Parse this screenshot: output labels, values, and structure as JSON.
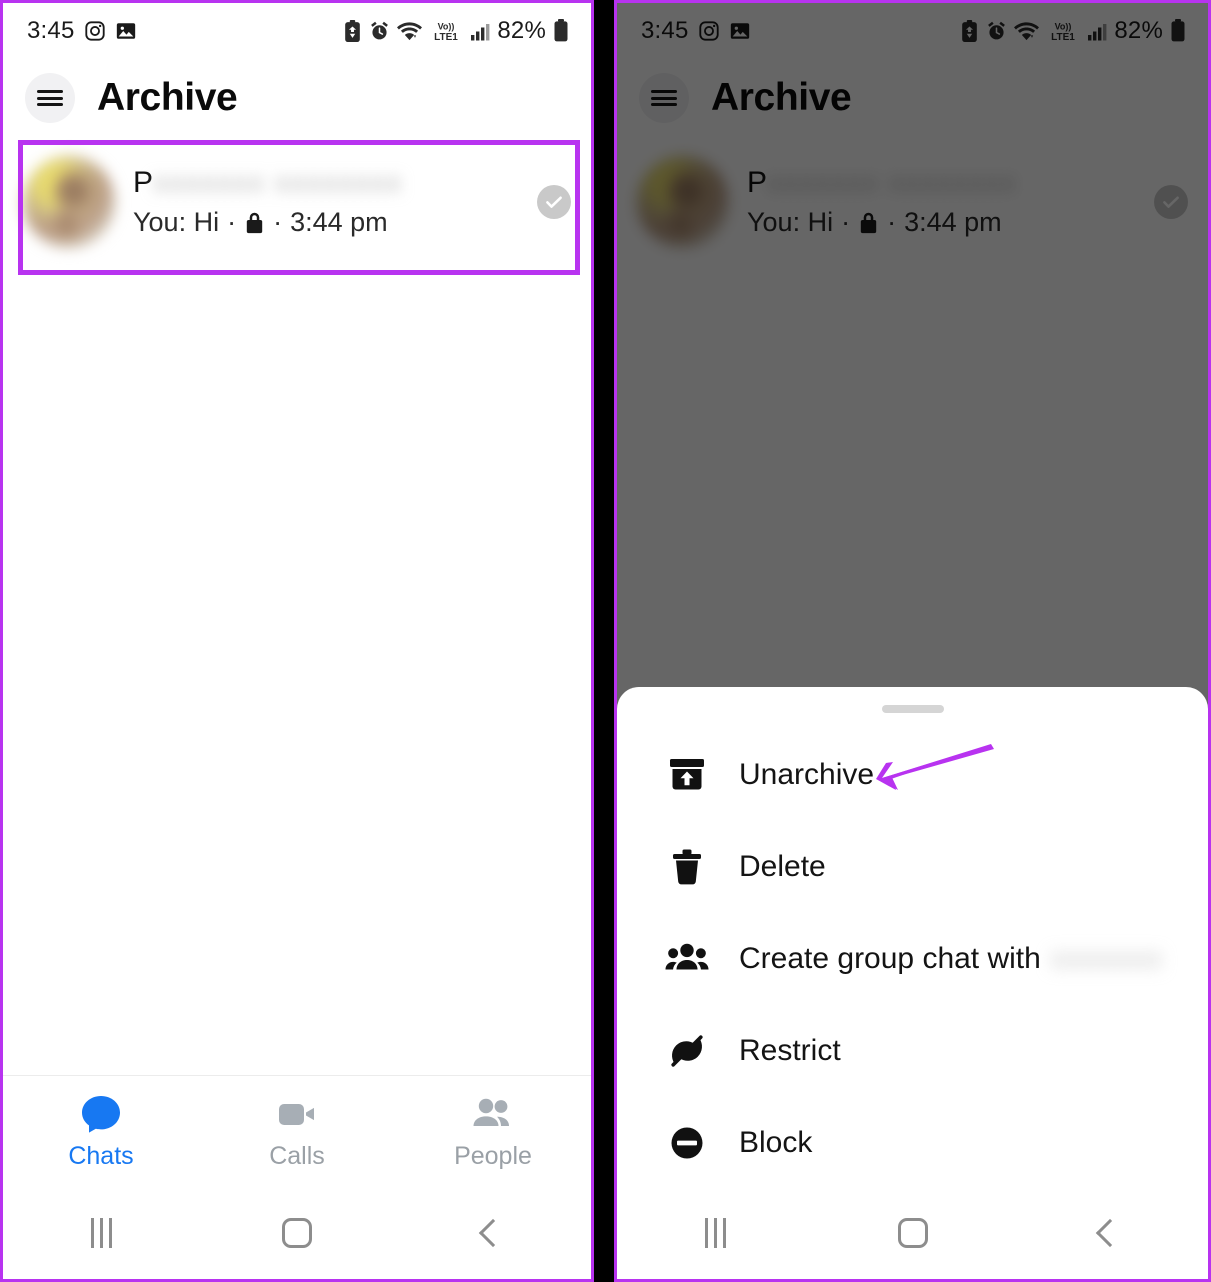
{
  "annotation": {
    "highlight_color": "#b833f0",
    "arrow_color": "#b833f0",
    "highlight_target": "archived-chat-row",
    "arrow_target": "unarchive-menu-item"
  },
  "status_bar": {
    "time": "3:45",
    "battery_percent": "82%",
    "network_label": "LTE1",
    "volte_label": "Vo))",
    "icons": [
      "instagram-icon",
      "photos-icon",
      "battery-saver-icon",
      "alarm-icon",
      "wifi-icon",
      "volte-icon",
      "signal-bars-icon",
      "battery-icon"
    ]
  },
  "app_bar": {
    "title": "Archive",
    "menu_icon": "hamburger-icon"
  },
  "chat_list": {
    "rows": [
      {
        "name_visible": "P",
        "name_blurred": "xxxxxxx xxxxxxxx",
        "snippet_prefix": "You: Hi",
        "separator": "·",
        "lock_icon": "lock-icon",
        "time": "3:44 pm",
        "status_icon": "sent-check-icon"
      }
    ]
  },
  "bottom_nav": {
    "items": [
      {
        "label": "Chats",
        "icon": "chat-bubble-icon",
        "active": true
      },
      {
        "label": "Calls",
        "icon": "video-camera-icon",
        "active": false
      },
      {
        "label": "People",
        "icon": "people-icon",
        "active": false
      }
    ],
    "active_color": "#1778f2",
    "idle_color": "#9aa0a6"
  },
  "android_nav": {
    "recents": "recents-icon",
    "home": "home-icon",
    "back": "back-icon"
  },
  "bottom_sheet": {
    "handle": "drag-handle",
    "items": [
      {
        "label": "Unarchive",
        "icon": "unarchive-icon",
        "suffix_blurred": ""
      },
      {
        "label": "Delete",
        "icon": "trash-icon",
        "suffix_blurred": ""
      },
      {
        "label": "Create group chat with",
        "icon": "group-people-icon",
        "suffix_blurred": "xxxxxxx"
      },
      {
        "label": "Restrict",
        "icon": "restrict-icon",
        "suffix_blurred": ""
      },
      {
        "label": "Block",
        "icon": "block-icon",
        "suffix_blurred": ""
      }
    ]
  }
}
